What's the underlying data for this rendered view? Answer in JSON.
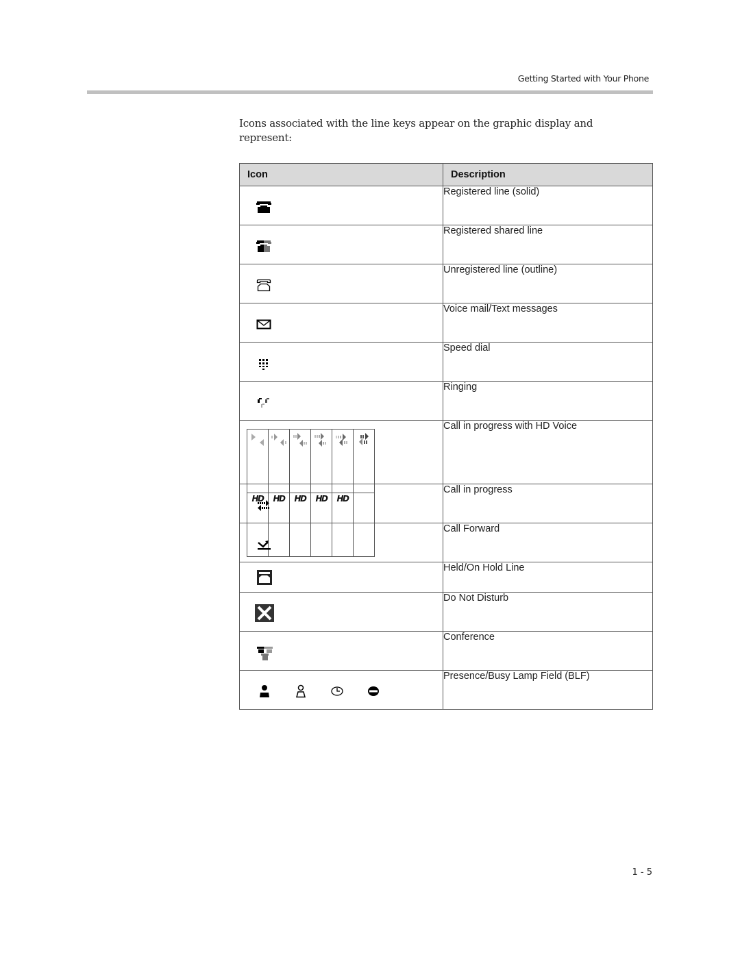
{
  "header": {
    "running_title": "Getting Started with Your Phone"
  },
  "intro_text": "Icons associated with the line keys appear on the graphic display and represent:",
  "table": {
    "columns": [
      "Icon",
      "Description"
    ],
    "rows": [
      {
        "icon": "registered-line-solid-icon",
        "description": "Registered line (solid)"
      },
      {
        "icon": "registered-shared-line-icon",
        "description": "Registered shared line"
      },
      {
        "icon": "unregistered-line-outline-icon",
        "description": "Unregistered line (outline)"
      },
      {
        "icon": "voicemail-envelope-icon",
        "description": "Voice mail/Text messages"
      },
      {
        "icon": "speed-dial-keypad-icon",
        "description": "Speed dial"
      },
      {
        "icon": "ringing-icon",
        "description": "Ringing"
      },
      {
        "icon": "hd-voice-animation-icons",
        "description": "Call in progress with HD Voice",
        "hd_labels": [
          "HD",
          "HD",
          "HD",
          "HD",
          "HD"
        ]
      },
      {
        "icon": "call-in-progress-icon",
        "description": "Call in progress"
      },
      {
        "icon": "call-forward-icon",
        "description": "Call Forward"
      },
      {
        "icon": "held-line-icon",
        "description": "Held/On Hold Line"
      },
      {
        "icon": "do-not-disturb-icon",
        "description": "Do Not Disturb"
      },
      {
        "icon": "conference-icon",
        "description": "Conference"
      },
      {
        "icon": "presence-blf-icons",
        "description": "Presence/Busy Lamp Field (BLF)",
        "presence_states": [
          "online-icon",
          "offline-icon",
          "away-icon",
          "busy-icon"
        ]
      }
    ]
  },
  "footer": {
    "page_number": "1 - 5"
  }
}
